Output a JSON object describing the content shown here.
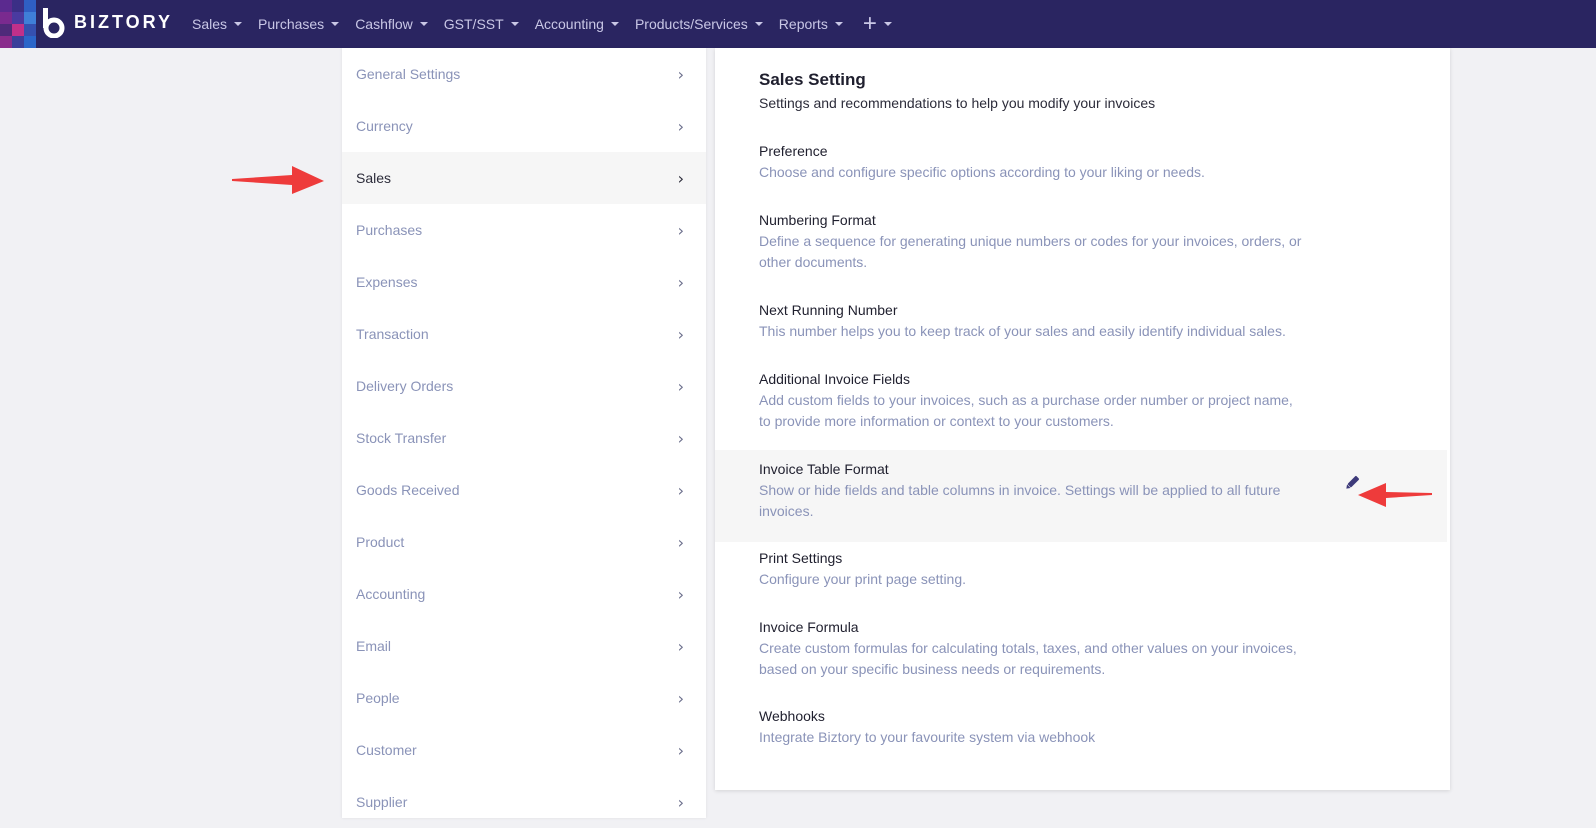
{
  "brand": {
    "name": "BIZTORY"
  },
  "nav": {
    "items": [
      {
        "label": "Sales"
      },
      {
        "label": "Purchases"
      },
      {
        "label": "Cashflow"
      },
      {
        "label": "GST/SST"
      },
      {
        "label": "Accounting"
      },
      {
        "label": "Products/Services"
      },
      {
        "label": "Reports"
      }
    ],
    "plus": "+"
  },
  "menu": {
    "items": [
      {
        "label": "General Settings"
      },
      {
        "label": "Currency"
      },
      {
        "label": "Sales"
      },
      {
        "label": "Purchases"
      },
      {
        "label": "Expenses"
      },
      {
        "label": "Transaction"
      },
      {
        "label": "Delivery Orders"
      },
      {
        "label": "Stock Transfer"
      },
      {
        "label": "Goods Received"
      },
      {
        "label": "Product"
      },
      {
        "label": "Accounting"
      },
      {
        "label": "Email"
      },
      {
        "label": "People"
      },
      {
        "label": "Customer"
      },
      {
        "label": "Supplier"
      }
    ],
    "active_index": 2
  },
  "panel": {
    "title": "Sales Setting",
    "subtitle": "Settings and recommendations to help you modify your invoices",
    "settings": [
      {
        "title": "Preference",
        "desc": "Choose and configure specific options according to your liking or needs."
      },
      {
        "title": "Numbering Format",
        "desc": "Define a sequence for generating unique numbers or codes for your invoices, orders, or other documents."
      },
      {
        "title": "Next Running Number",
        "desc": "This number helps you to keep track of your sales and easily identify individual sales."
      },
      {
        "title": "Additional Invoice Fields",
        "desc": "Add custom fields to your invoices, such as a purchase order number or project name, to provide more information or context to your customers."
      },
      {
        "title": "Invoice Table Format",
        "desc": "Show or hide fields and table columns in invoice. Settings will be applied to all future invoices."
      },
      {
        "title": "Print Settings",
        "desc": "Configure your print page setting."
      },
      {
        "title": "Invoice Formula",
        "desc": "Create custom formulas for calculating totals, taxes, and other values on your invoices, based on your specific business needs or requirements."
      },
      {
        "title": "Webhooks",
        "desc": "Integrate Biztory to your favourite system via webhook"
      }
    ]
  },
  "colors": {
    "navbar": "#2a2561",
    "annotation_arrow": "#ee3b3b",
    "edit_icon": "#3d3a7a"
  }
}
